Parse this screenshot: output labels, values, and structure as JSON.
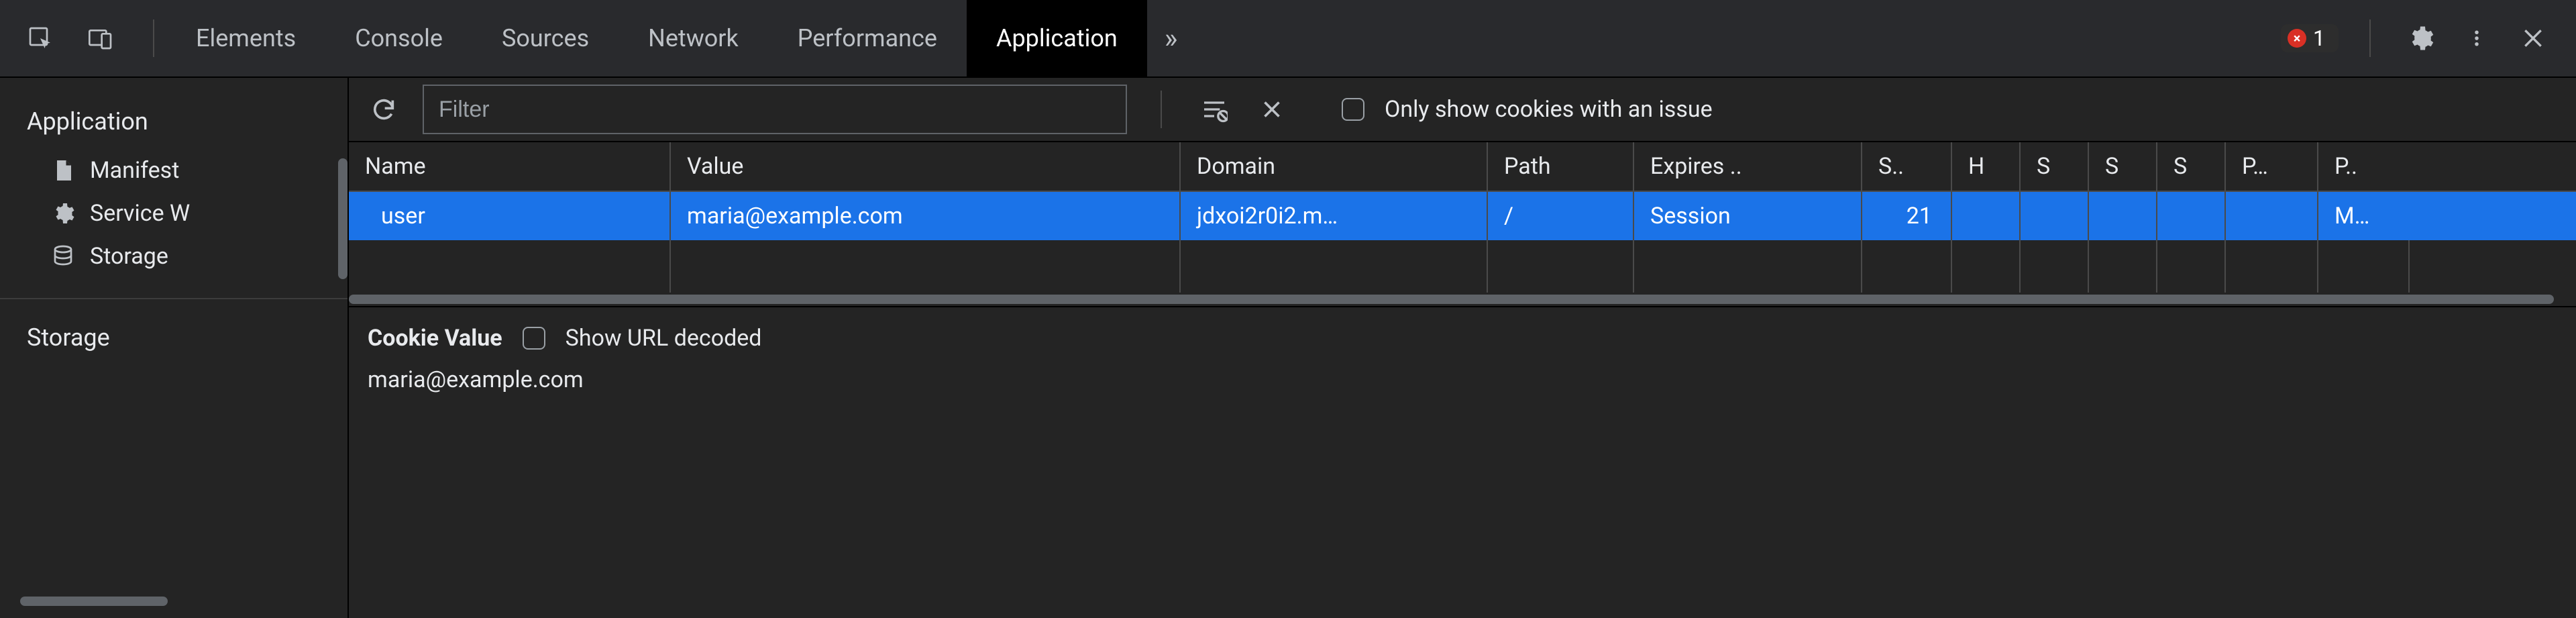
{
  "tabs": {
    "items": [
      "Elements",
      "Console",
      "Sources",
      "Network",
      "Performance",
      "Application"
    ],
    "active": 5,
    "overflow_glyph": "»"
  },
  "errors": {
    "count": "1",
    "glyph": "×"
  },
  "sidebar": {
    "section1": {
      "title": "Application",
      "items": [
        {
          "label": "Manifest",
          "icon": "manifest"
        },
        {
          "label": "Service W",
          "icon": "gear"
        },
        {
          "label": "Storage",
          "icon": "storage"
        }
      ]
    },
    "section2": {
      "title": "Storage"
    }
  },
  "toolbar": {
    "filter_placeholder": "Filter",
    "issue_label": "Only show cookies with an issue"
  },
  "table": {
    "columns": [
      "Name",
      "Value",
      "Domain",
      "Path",
      "Expires ..",
      "S..",
      "H",
      "S",
      "S",
      "S",
      "P…",
      "P.."
    ],
    "rows": [
      {
        "name": "user",
        "value": "maria@example.com",
        "domain": "jdxoi2r0i2.m…",
        "path": "/",
        "expires": "Session",
        "size": "21",
        "h": "",
        "s1": "",
        "s2": "",
        "s3": "",
        "p1": "",
        "p2": "M…"
      }
    ]
  },
  "detail": {
    "title": "Cookie Value",
    "decoded_label": "Show URL decoded",
    "value": "maria@example.com"
  }
}
